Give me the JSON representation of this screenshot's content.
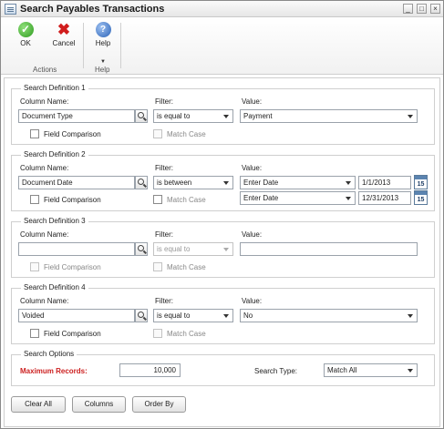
{
  "window": {
    "title": "Search Payables Transactions",
    "controls": [
      "_",
      "□",
      "×"
    ]
  },
  "ribbon": {
    "ok_label": "OK",
    "cancel_label": "Cancel",
    "help_label": "Help",
    "actions_group": "Actions",
    "help_group": "Help",
    "ok_icon": "check-icon",
    "cancel_icon": "x-icon",
    "help_icon": "help-icon"
  },
  "labels": {
    "column_name": "Column Name:",
    "filter": "Filter:",
    "value": "Value:",
    "field_comparison": "Field Comparison",
    "match_case": "Match Case"
  },
  "def1": {
    "legend": "Search Definition 1",
    "column": "Document Type",
    "filter": "is equal to",
    "value": "Payment"
  },
  "def2": {
    "legend": "Search Definition 2",
    "column": "Document Date",
    "filter": "is between",
    "value1_type": "Enter Date",
    "value1_date": "1/1/2013",
    "value2_type": "Enter Date",
    "value2_date": "12/31/2013",
    "calendar_day": "15"
  },
  "def3": {
    "legend": "Search Definition 3",
    "column": "",
    "filter": "is equal to",
    "value": ""
  },
  "def4": {
    "legend": "Search Definition 4",
    "column": "Voided",
    "filter": "is equal to",
    "value": "No"
  },
  "options": {
    "legend": "Search Options",
    "max_records_label": "Maximum Records:",
    "max_records": "10,000",
    "search_type_label": "Search Type:",
    "search_type": "Match All"
  },
  "buttons": {
    "clear_all": "Clear All",
    "columns": "Columns",
    "order_by": "Order By"
  },
  "colors": {
    "required_label": "#cc1f1f",
    "ok_icon": "#2e9a1f",
    "cancel_icon": "#d11d1d",
    "help_icon": "#2a62b7"
  }
}
